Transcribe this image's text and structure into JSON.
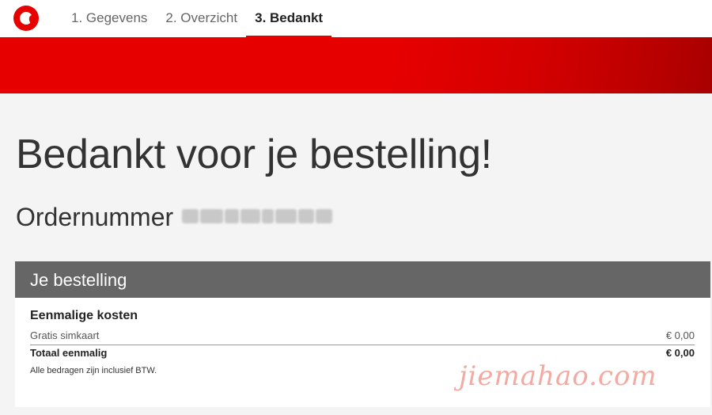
{
  "header": {
    "steps": [
      {
        "label": "1. Gegevens"
      },
      {
        "label": "2. Overzicht"
      },
      {
        "label": "3. Bedankt"
      }
    ],
    "active_step": 3,
    "accent_color": "#e60000"
  },
  "main": {
    "title": "Bedankt voor je bestelling!",
    "order_label": "Ordernummer",
    "order_number": ""
  },
  "order_card": {
    "title": "Je bestelling",
    "section_title": "Eenmalige kosten",
    "items": [
      {
        "label": "Gratis simkaart",
        "amount": "€ 0,00"
      }
    ],
    "total": {
      "label": "Totaal eenmalig",
      "amount": "€ 0,00"
    },
    "note": "Alle bedragen zijn inclusief BTW."
  },
  "watermark": "jiemahao.com"
}
